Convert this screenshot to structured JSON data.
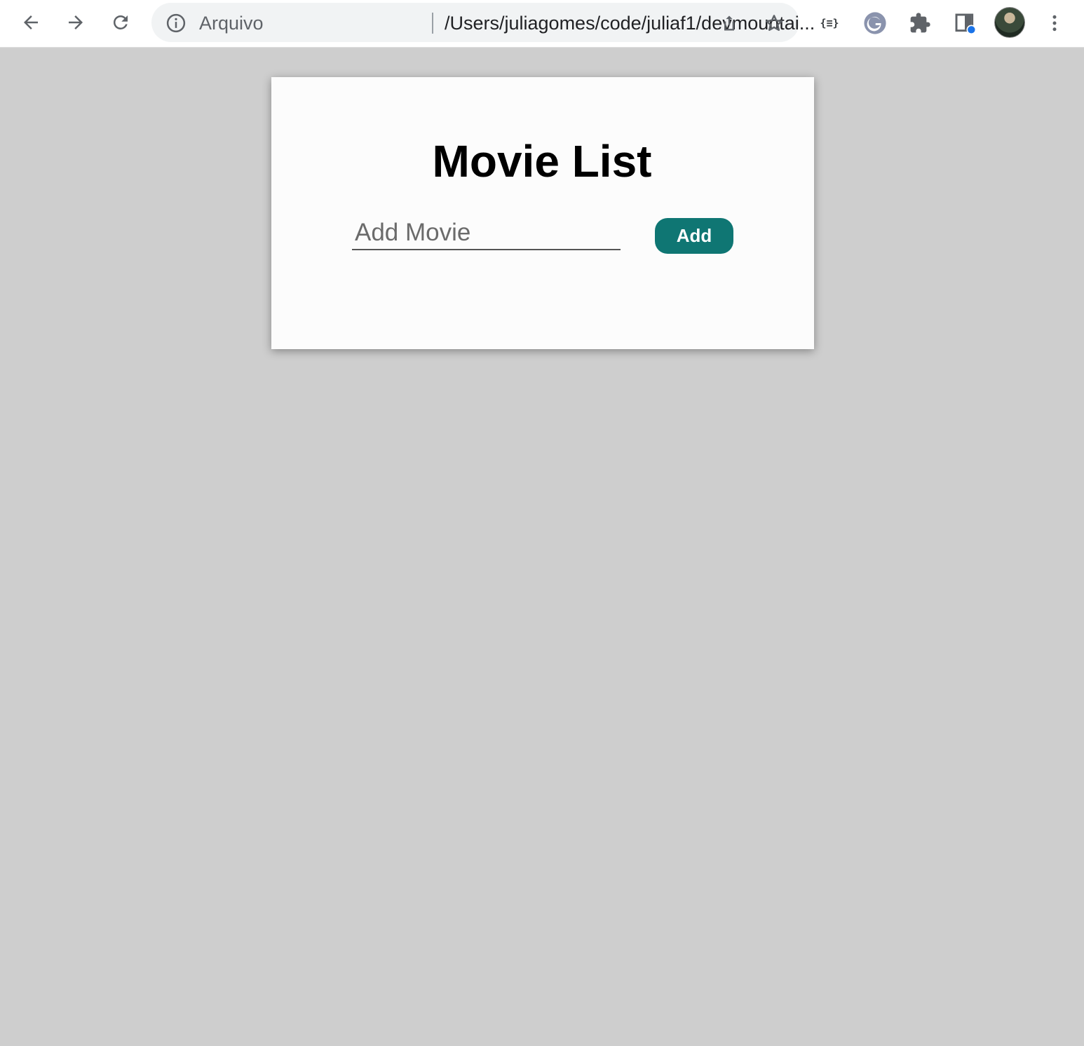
{
  "browser": {
    "omnibox": {
      "scheme_label": "Arquivo",
      "url": "/Users/juliagomes/code/juliaf1/devmountai..."
    },
    "icons": {
      "back": "back-arrow-icon",
      "forward": "forward-arrow-icon",
      "reload": "reload-icon",
      "info": "info-icon",
      "share": "share-icon",
      "bookmark": "star-icon",
      "json_extension": "json-formatter-icon",
      "json_extension_label": "{≡}",
      "grammarly": "grammarly-icon",
      "extensions": "puzzle-icon",
      "reading_mode": "sidepanel-icon",
      "menu": "kebab-menu-icon"
    }
  },
  "app": {
    "title": "Movie List",
    "input": {
      "placeholder": "Add Movie",
      "value": ""
    },
    "add_button_label": "Add"
  },
  "colors": {
    "page_background": "#cecece",
    "card_background": "#fcfcfc",
    "button_background": "#0f7673",
    "button_text": "#ffffff"
  }
}
